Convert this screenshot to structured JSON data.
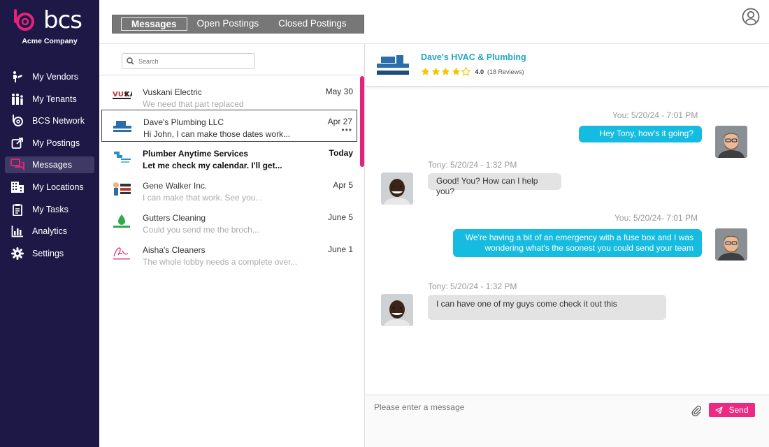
{
  "brand": {
    "name": "bcs",
    "company": "Acme Company",
    "accent": "#e6237a",
    "sidebar_bg": "#1d1846"
  },
  "sidebar": {
    "items": [
      {
        "label": "My Vendors",
        "icon": "vendors-icon"
      },
      {
        "label": "My Tenants",
        "icon": "tenants-icon"
      },
      {
        "label": "BCS Network",
        "icon": "bcs-network-icon"
      },
      {
        "label": "My Postings",
        "icon": "postings-icon"
      },
      {
        "label": "Messages",
        "icon": "messages-icon",
        "active": true
      },
      {
        "label": "My Locations",
        "icon": "locations-icon"
      },
      {
        "label": "My Tasks",
        "icon": "tasks-icon"
      },
      {
        "label": "Analytics",
        "icon": "analytics-icon"
      },
      {
        "label": "Settings",
        "icon": "settings-icon"
      }
    ]
  },
  "tabs": [
    {
      "label": "Messages",
      "active": true
    },
    {
      "label": "Open Postings"
    },
    {
      "label": "Closed Postings"
    }
  ],
  "search": {
    "placeholder": "Search"
  },
  "conversations": [
    {
      "name": "Vuskani Electric",
      "date": "May 30",
      "preview": "We need that part replaced",
      "logo": "vuskani-logo"
    },
    {
      "name": "Dave's Plumbing LLC",
      "date": "Apr 27",
      "preview": "Hi John, I can make those dates work...",
      "selected": true,
      "more": "•••",
      "logo": "plumbing-brothers-logo"
    },
    {
      "name": "Plumber Anytime Services",
      "date": "Today",
      "preview": "Let me check my calendar. I'll get...",
      "unread": true,
      "logo": "plumber-anytime-logo"
    },
    {
      "name": "Gene Walker Inc.",
      "date": "Apr 5",
      "preview": "I can make that work. See you...",
      "logo": "gene-walker-logo"
    },
    {
      "name": "Gutters Cleaning",
      "date": "June 5",
      "preview": "Could you send me the broch...",
      "logo": "gutters-cleaning-logo"
    },
    {
      "name": "Aisha's Cleaners",
      "date": "June 1",
      "preview": "The whole lobby needs a complete over...",
      "logo": "aishas-cleaners-logo"
    }
  ],
  "chat": {
    "vendor_name": "Dave's HVAC & Plumbing",
    "rating": "4.0",
    "reviews": "(18 Reviews)",
    "stars_filled": 4,
    "stars_total": 5,
    "messages": [
      {
        "direction": "out",
        "meta": "You: 5/20/24 - 7:01 PM",
        "text": "Hey Tony, how's it going?"
      },
      {
        "direction": "in",
        "meta": "Tony: 5/20/24 - 1:32 PM",
        "text": "Good! You? How can I help you?"
      },
      {
        "direction": "out",
        "meta": "You: 5/20/24- 7:01 PM",
        "text_line1": "We're having a bit of an emergency with a fuse box and I was",
        "text_line2": "wondering what's the soonest you could send your team"
      },
      {
        "direction": "in",
        "meta": "Tony: 5/20/24 - 1:32 PM",
        "text": "I can have one of my guys come check it out this"
      }
    ]
  },
  "composer": {
    "placeholder": "Please enter a message",
    "send_label": "Send"
  }
}
